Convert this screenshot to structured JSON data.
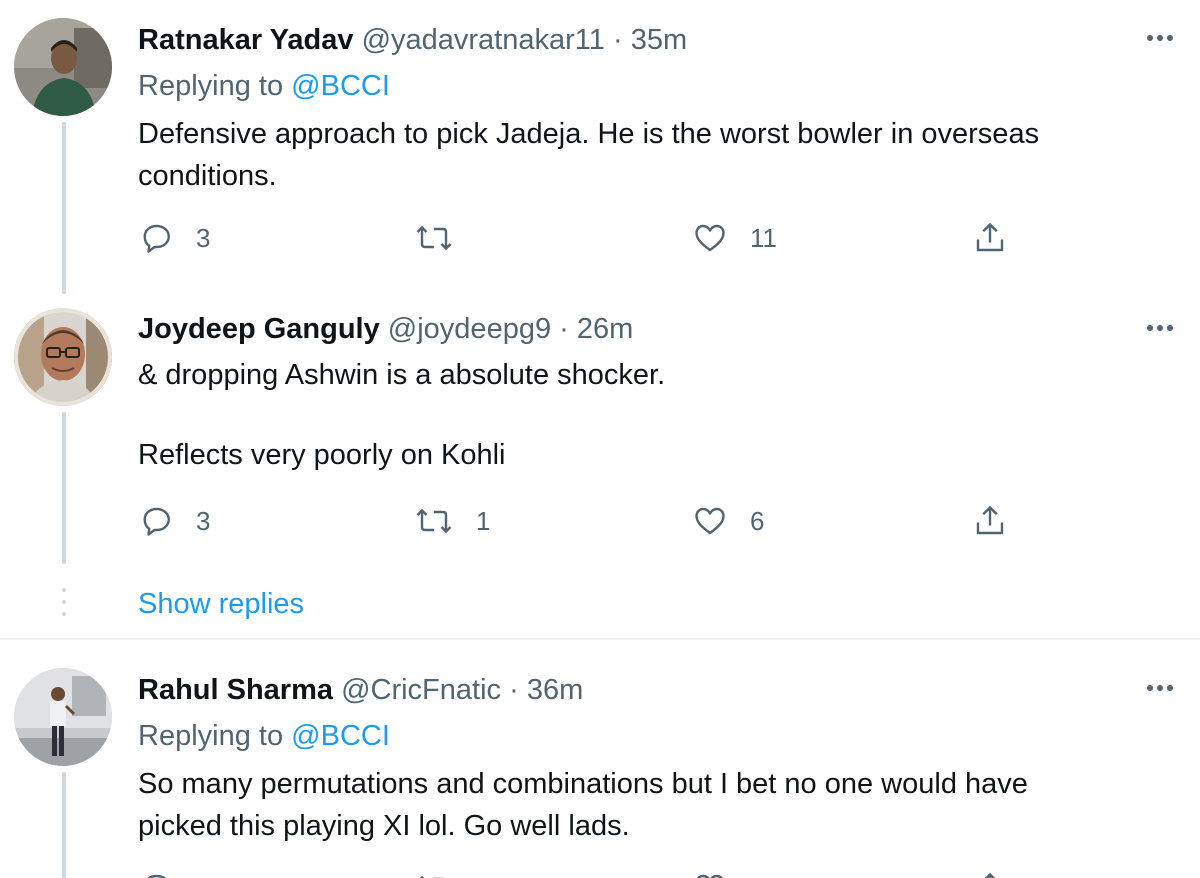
{
  "tweets": [
    {
      "display_name": "Ratnakar Yadav",
      "handle": "@yadavratnakar11",
      "separator": "·",
      "time": "35m",
      "replying_prefix": "Replying to",
      "replying_mention": "@BCCI",
      "text_lines": [
        "Defensive approach to pick Jadeja. He is the worst bowler in overseas",
        "conditions."
      ],
      "reply_count": "3",
      "retweet_count": "",
      "like_count": "11",
      "avatar_icon": "profile-photo-man-green-shirt"
    },
    {
      "display_name": "Joydeep Ganguly",
      "handle": "@joydeepg9",
      "separator": "·",
      "time": "26m",
      "text_lines": [
        "& dropping Ashwin is a absolute shocker.",
        "",
        "Reflects very poorly on Kohli"
      ],
      "reply_count": "3",
      "retweet_count": "1",
      "like_count": "6",
      "avatar_icon": "profile-photo-man-glasses"
    },
    {
      "display_name": "Rahul Sharma",
      "handle": "@CricFnatic",
      "separator": "·",
      "time": "36m",
      "replying_prefix": "Replying to",
      "replying_mention": "@BCCI",
      "text_lines": [
        "So many permutations and combinations but I bet no one would have",
        "picked this playing XI lol. Go well lads."
      ],
      "avatar_icon": "profile-photo-man-standing"
    }
  ],
  "show_replies_label": "Show replies",
  "icons": {
    "reply": "reply-icon",
    "retweet": "retweet-icon",
    "like": "heart-icon",
    "share": "share-icon",
    "more": "more-icon"
  },
  "colors": {
    "text": "#0f1419",
    "secondary": "#536471",
    "accent": "#1d9bf0",
    "thread_line": "#cfd9de"
  }
}
